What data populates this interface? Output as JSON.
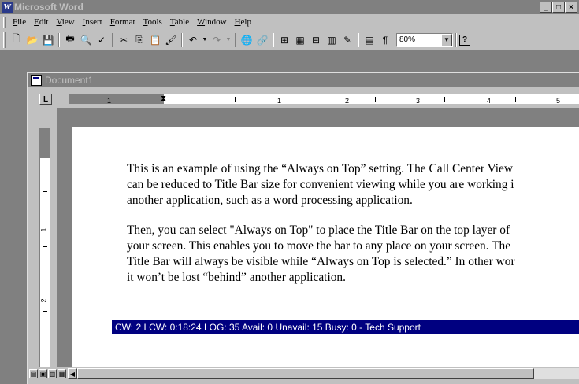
{
  "app": {
    "title": "Microsoft Word",
    "icon_letter": "W",
    "window_buttons": {
      "minimize": "_",
      "maximize": "□",
      "close": "×"
    }
  },
  "menubar": {
    "items": [
      {
        "label": "File"
      },
      {
        "label": "Edit"
      },
      {
        "label": "View"
      },
      {
        "label": "Insert"
      },
      {
        "label": "Format"
      },
      {
        "label": "Tools"
      },
      {
        "label": "Table"
      },
      {
        "label": "Window"
      },
      {
        "label": "Help"
      }
    ]
  },
  "toolbar": {
    "zoom_value": "80%",
    "icons": {
      "new": "🗋",
      "open": "📂",
      "save": "💾",
      "print": "🖶",
      "preview": "🔍",
      "spell": "✓",
      "cut": "✂",
      "copy": "⎘",
      "paste": "📋",
      "format_painter": "🖌",
      "undo": "↶",
      "redo": "↷",
      "web": "🌐",
      "hyperlink": "🔗",
      "table": "⊞",
      "insert_table": "▦",
      "excel": "⊟",
      "columns": "▥",
      "drawing": "✎",
      "docmap": "▤",
      "pilcrow": "¶",
      "help": "?",
      "dropdown": "▼"
    }
  },
  "document": {
    "title": "Document1",
    "tab_selector": "L",
    "indent_marker": "⧗",
    "ruler_numbers": [
      "1",
      "1",
      "2",
      "3",
      "4",
      "5"
    ],
    "vruler_numbers": [
      "1",
      "2"
    ],
    "paragraph1": [
      "This is an example of using the “Always on Top” setting. The Call Center View",
      "can be reduced to Title Bar size for convenient viewing while you are working i",
      "another application, such as a word processing application."
    ],
    "paragraph2": [
      "Then, you can select \"Always on Top\" to place the Title Bar on the top layer of",
      "your screen. This enables you to move the bar to any place on your screen. The",
      "Title Bar will always be visible while “Always on Top is selected.” In other wor",
      "it won’t be lost “behind” another application."
    ]
  },
  "ccv_bar": {
    "text": "CW: 2  LCW:  0:18:24  LOG: 35  Avail: 0  Unavail: 15  Busy: 0 - Tech Support"
  },
  "bottombar": {
    "view_icons": [
      "▤",
      "▣",
      "▥",
      "▦"
    ],
    "scroll_left": "◀"
  },
  "colors": {
    "chrome": "#c0c0c0",
    "inactive_title": "#808080",
    "ccv_bar": "#000080"
  }
}
